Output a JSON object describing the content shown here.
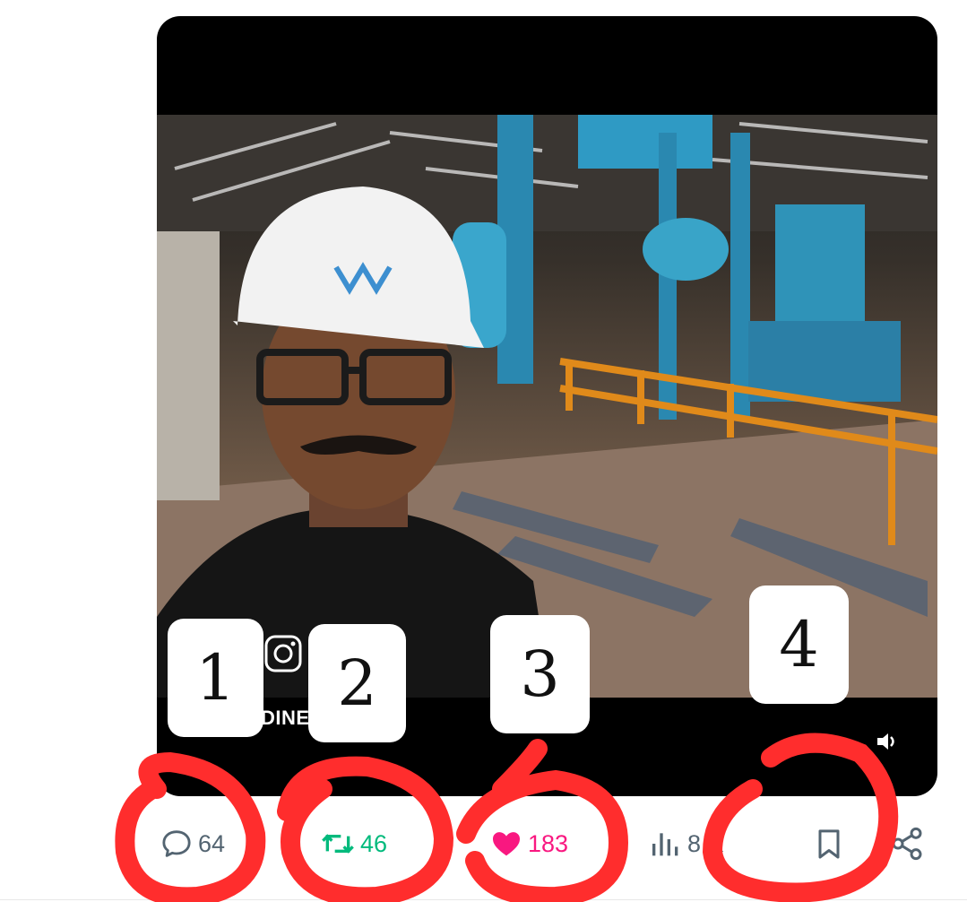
{
  "video": {
    "watermark": "DINES      A_3896"
  },
  "badges": [
    "1",
    "2",
    "3",
    "4"
  ],
  "actions": {
    "replies": "64",
    "reposts": "46",
    "likes": "183",
    "views": "8 K"
  },
  "colors": {
    "reply": "#536471",
    "repost": "#00ba7c",
    "like": "#f91880",
    "annotation": "#ff2d2d"
  }
}
